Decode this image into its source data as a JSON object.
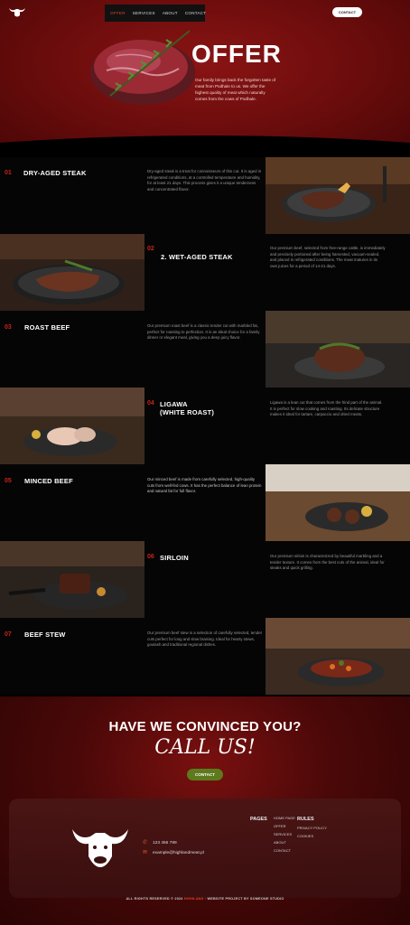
{
  "nav": {
    "items": [
      "OFFER",
      "SERVICES",
      "ABOUT",
      "CONTACT"
    ],
    "active_index": 0,
    "contact_button": "CONTACT"
  },
  "hero": {
    "title": "OFFER",
    "description": "Our family brings back the forgotten taste of meat from Podhale to us. We offer the highest quality of meat which naturally comes from the cows of Podhale."
  },
  "offers": [
    {
      "num": "01",
      "title": "DRY-AGED STEAK",
      "text": "Dry-aged steak is a treat for connoisseurs of this cut. It is aged in refrigerated conditions, at a controlled temperature and humidity, for at least 21 days. This process gives it a unique tenderness and concentrated flavor."
    },
    {
      "num": "02",
      "title": "2. WET-AGED STEAK",
      "text": "Our premium beef, selected from free-range cattle, is immediately and precisely portioned after being harvested, vacuum-sealed, and placed in refrigerated conditions. The meat matures in its own juices for a period of 14-21 days."
    },
    {
      "num": "03",
      "title": "ROAST BEEF",
      "text": "Our premium roast beef is a classic tender cut with marbled fat, perfect for roasting to perfection. It is an ideal choice for a family dinner or elegant meal, giving you a deep juicy flavor."
    },
    {
      "num": "04",
      "title": "LIGAWA\n(WHITE ROAST)",
      "text": "Ligawa is a lean cut that comes from the hind part of the animal. It is perfect for slow cooking and roasting. Its delicate structure makes it ideal for tartare, carpaccio and dried meats."
    },
    {
      "num": "05",
      "title": "MINCED BEEF",
      "text": "Our minced beef is made from carefully selected, high-quality cuts from well-fed cows. It has the perfect balance of lean protein and natural fat for full flavor."
    },
    {
      "num": "06",
      "title": "SIRLOIN",
      "text": "Our premium sirloin is characterized by beautiful marbling and a tender texture. It comes from the best cuts of the animal, ideal for steaks and quick grilling."
    },
    {
      "num": "07",
      "title": "BEEF STEW",
      "text": "Our premium beef stew is a selection of carefully selected, tender cuts perfect for long and slow braising. Ideal for hearty stews, goulash and traditional regional dishes."
    }
  ],
  "cta": {
    "heading": "HAVE WE CONVINCED YOU?",
    "call": "CALL US!",
    "button": "CONTACT"
  },
  "footer": {
    "phone": "123 456 789",
    "email": "example@highlandmeat.pl",
    "pages_heading": "PAGES",
    "pages": [
      "HOME PAGE",
      "OFFER",
      "SERVICES",
      "ABOUT",
      "CONTACT"
    ],
    "rules_heading": "RULES",
    "rules": [
      "PRIVACY POLICY",
      "COOKIES"
    ],
    "copyright_prefix": "ALL RIGHTS RESERVED © 2024 ",
    "copyright_brand": "HIGHLAND",
    "copyright_suffix": " · WEBSITE PROJECT BY SOMEONE STUDIO"
  },
  "colors": {
    "brand_red": "#6a0c0c",
    "accent": "#c8231b",
    "button_green": "#5d7a1c"
  }
}
